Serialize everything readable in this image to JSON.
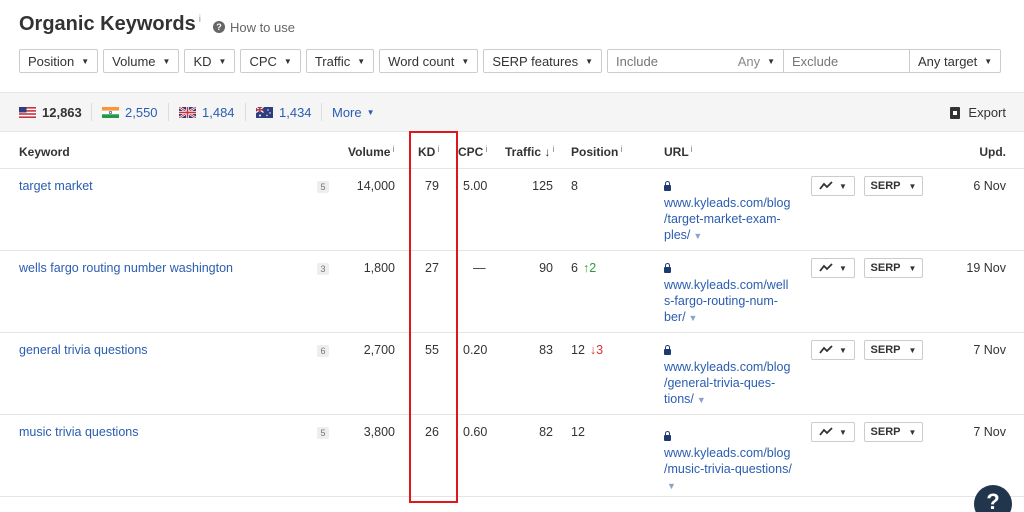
{
  "header": {
    "title": "Organic Keywords",
    "info": "i",
    "how_to_use": "How to use"
  },
  "filters": {
    "position": "Position",
    "volume": "Volume",
    "kd": "KD",
    "cpc": "CPC",
    "traffic": "Traffic",
    "word_count": "Word count",
    "serp_features": "SERP features",
    "include_placeholder": "Include",
    "any": "Any",
    "exclude_placeholder": "Exclude",
    "any_target": "Any target"
  },
  "countries": [
    {
      "flag": "us-flag-icon",
      "count": "12,863"
    },
    {
      "flag": "in-flag-icon",
      "count": "2,550"
    },
    {
      "flag": "gb-flag-icon",
      "count": "1,484"
    },
    {
      "flag": "au-flag-icon",
      "count": "1,434"
    }
  ],
  "more_label": "More",
  "export_label": "Export",
  "columns": {
    "keyword": "Keyword",
    "volume": "Volume",
    "kd": "KD",
    "cpc": "CPC",
    "traffic": "Traffic",
    "position": "Position",
    "url": "URL",
    "updated": "Upd.",
    "info": "i",
    "sort": "↓"
  },
  "buttons": {
    "serp": "SERP"
  },
  "rows": [
    {
      "keyword": "target market",
      "words": "5",
      "volume": "14,000",
      "kd": "79",
      "cpc": "5.00",
      "traffic": "125",
      "position": "8",
      "change": "",
      "url_line1": "www.kyleads.com/blog",
      "url_line2": "/target-market-exam-",
      "url_line3": "ples/",
      "updated": "6 Nov"
    },
    {
      "keyword": "wells fargo routing number washington",
      "words": "3",
      "volume": "1,800",
      "kd": "27",
      "cpc": "—",
      "traffic": "90",
      "position": "6",
      "change": "↑2",
      "url_line1": "www.kyleads.com/well",
      "url_line2": "s-fargo-routing-num-",
      "url_line3": "ber/",
      "updated": "19 Nov"
    },
    {
      "keyword": "general trivia questions",
      "words": "6",
      "volume": "2,700",
      "kd": "55",
      "cpc": "0.20",
      "traffic": "83",
      "position": "12",
      "change": "↓3",
      "url_line1": "www.kyleads.com/blog",
      "url_line2": "/general-trivia-ques-",
      "url_line3": "tions/",
      "updated": "7 Nov"
    },
    {
      "keyword": "music trivia questions",
      "words": "5",
      "volume": "3,800",
      "kd": "26",
      "cpc": "0.60",
      "traffic": "82",
      "position": "12",
      "change": "",
      "url_line1": "www.kyleads.com/blog",
      "url_line2": "/music-trivia-questions/",
      "url_line3": "",
      "updated": "7 Nov"
    }
  ],
  "help_label": "?"
}
